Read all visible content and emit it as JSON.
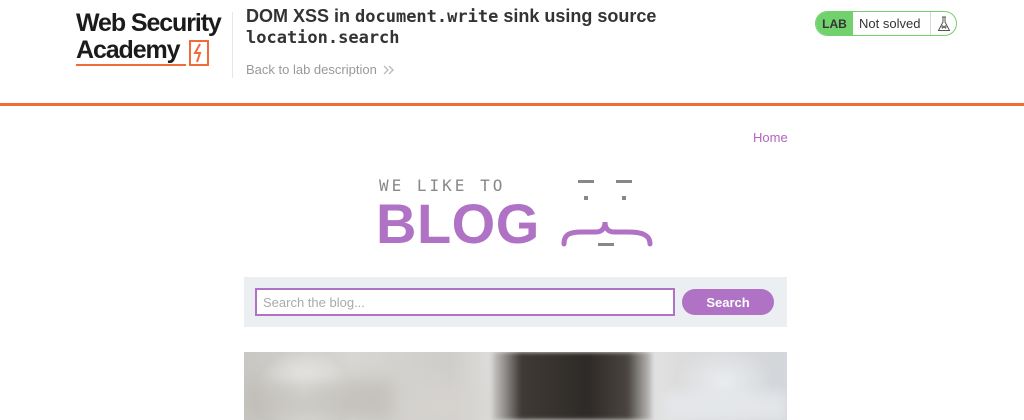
{
  "academy": {
    "logo_line1": "Web Security",
    "logo_line2": "Academy",
    "lab_title_prefix": "DOM XSS in ",
    "lab_title_code1": "document.write",
    "lab_title_mid": " sink using source ",
    "lab_title_code2": "location.search",
    "back_link": "Back to lab description",
    "lab_badge": "LAB",
    "lab_status": "Not solved",
    "accent_color": "#f26a35",
    "status_color": "#70d16d"
  },
  "blog": {
    "nav_home": "Home",
    "banner_top": "WE LIKE TO",
    "banner_main": "BLOG",
    "search": {
      "placeholder": "Search the blog...",
      "value": "",
      "button_label": "Search"
    },
    "brand_color": "#b072c4"
  },
  "icons": {
    "academy_logo": "lightning-bolt-icon",
    "back_chevron": "double-chevron-right-icon",
    "lab_flask": "flask-icon",
    "blog_face": "curly-brace-face-icon"
  }
}
